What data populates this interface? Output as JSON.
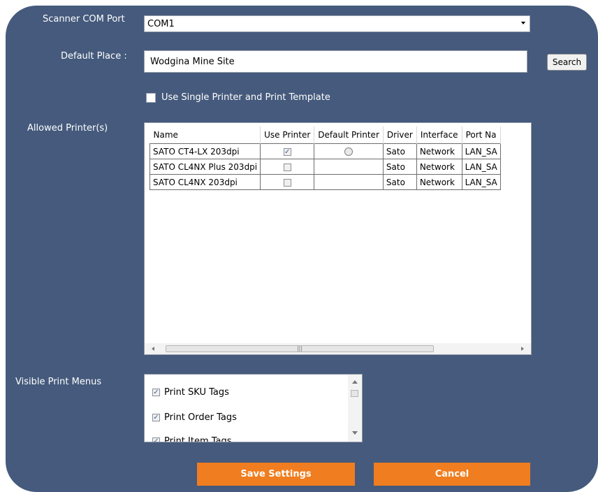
{
  "scanner": {
    "label": "Scanner COM Port",
    "value": "COM1"
  },
  "place": {
    "label": "Default Place :",
    "value": "Wodgina Mine Site",
    "search_label": "Search"
  },
  "single_printer": {
    "label": "Use Single Printer and Print Template",
    "checked": false
  },
  "printers": {
    "label": "Allowed Printer(s)",
    "columns": [
      "Name",
      "Use Printer",
      "Default Printer",
      "Driver",
      "Interface",
      "Port Na"
    ],
    "rows": [
      {
        "name": "SATO CT4-LX 203dpi",
        "use": true,
        "default_radio": true,
        "driver": "Sato",
        "interface": "Network",
        "port": "LAN_SA"
      },
      {
        "name": "SATO CL4NX Plus 203dpi",
        "use": false,
        "default_radio": false,
        "driver": "Sato",
        "interface": "Network",
        "port": "LAN_SA"
      },
      {
        "name": "SATO CL4NX 203dpi",
        "use": false,
        "default_radio": false,
        "driver": "Sato",
        "interface": "Network",
        "port": "LAN_SA"
      }
    ]
  },
  "print_menus": {
    "label": "Visible Print Menus",
    "items": [
      {
        "label": "Print SKU Tags",
        "checked": true
      },
      {
        "label": "Print Order Tags",
        "checked": true
      },
      {
        "label": "Print Item Tags",
        "checked": true
      }
    ]
  },
  "buttons": {
    "save": "Save Settings",
    "cancel": "Cancel"
  },
  "colors": {
    "panel": "#455a7c",
    "accent_button": "#f07d1f"
  }
}
